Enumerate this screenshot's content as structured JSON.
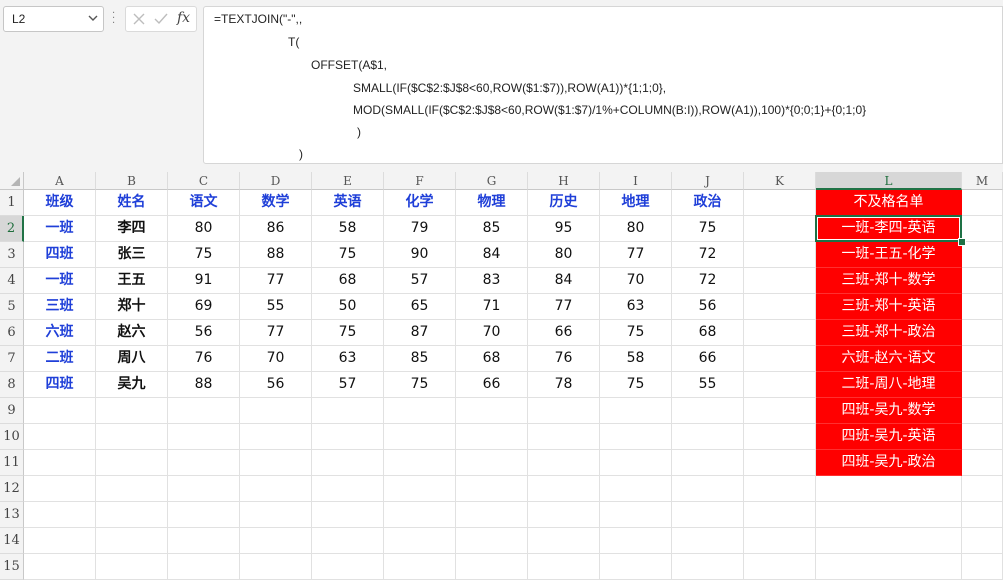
{
  "name_box": {
    "value": "L2"
  },
  "formula_bar": {
    "fx_label": "fx",
    "lines": [
      "=TEXTJOIN(\"-\",,",
      "T(",
      "OFFSET(A$1,",
      "SMALL(IF($C$2:$J$8<60,ROW($1:$7)),ROW(A1))*{1;1;0},",
      "MOD(SMALL(IF($C$2:$J$8<60,ROW($1:$7)/1%+COLUMN(B:I)),ROW(A1)),100)*{0;0;1}+{0;1;0}",
      ")",
      ")"
    ]
  },
  "columns": [
    "A",
    "B",
    "C",
    "D",
    "E",
    "F",
    "G",
    "H",
    "I",
    "J",
    "K",
    "L",
    "M"
  ],
  "rows": [
    "1",
    "2",
    "3",
    "4",
    "5",
    "6",
    "7",
    "8",
    "9",
    "10",
    "11",
    "12",
    "13",
    "14",
    "15"
  ],
  "selected": {
    "column": "L",
    "row": "2"
  },
  "table": {
    "headers": [
      "班级",
      "姓名",
      "语文",
      "数学",
      "英语",
      "化学",
      "物理",
      "历史",
      "地理",
      "政治"
    ],
    "data": [
      [
        "一班",
        "李四",
        "80",
        "86",
        "58",
        "79",
        "85",
        "95",
        "80",
        "75"
      ],
      [
        "四班",
        "张三",
        "75",
        "88",
        "75",
        "90",
        "84",
        "80",
        "77",
        "72"
      ],
      [
        "一班",
        "王五",
        "91",
        "77",
        "68",
        "57",
        "83",
        "84",
        "70",
        "72"
      ],
      [
        "三班",
        "郑十",
        "69",
        "55",
        "50",
        "65",
        "71",
        "77",
        "63",
        "56"
      ],
      [
        "六班",
        "赵六",
        "56",
        "77",
        "75",
        "87",
        "70",
        "66",
        "75",
        "68"
      ],
      [
        "二班",
        "周八",
        "76",
        "70",
        "63",
        "85",
        "68",
        "76",
        "58",
        "66"
      ],
      [
        "四班",
        "吴九",
        "88",
        "56",
        "57",
        "75",
        "66",
        "78",
        "75",
        "55"
      ]
    ]
  },
  "fail_list": {
    "header": "不及格名单",
    "items": [
      "一班-李四-英语",
      "一班-王五-化学",
      "三班-郑十-数学",
      "三班-郑十-英语",
      "三班-郑十-政治",
      "六班-赵六-语文",
      "二班-周八-地理",
      "四班-吴九-数学",
      "四班-吴九-英语",
      "四班-吴九-政治"
    ]
  },
  "colors": {
    "header_blue": "#1f3fd8",
    "fail_red": "#ff0000",
    "selection_green": "#1e7145"
  }
}
